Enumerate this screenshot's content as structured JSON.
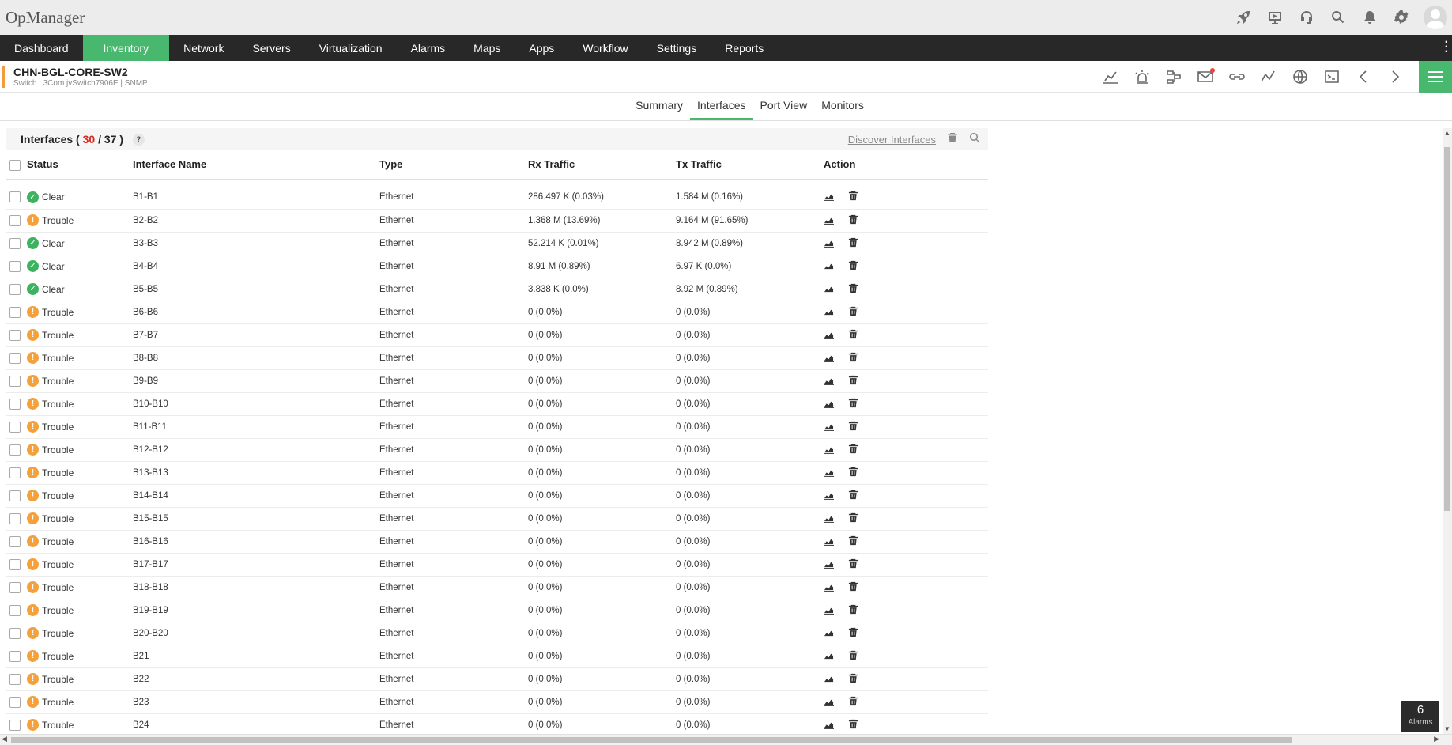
{
  "app": {
    "title": "OpMan​ager"
  },
  "nav": {
    "items": [
      "Dashboard",
      "Inventory",
      "Network",
      "Servers",
      "Virtualization",
      "Alarms",
      "Maps",
      "Apps",
      "Workflow",
      "Settings",
      "Reports"
    ],
    "active": "Inventory"
  },
  "device": {
    "name": "CHN-BGL-CORE-SW2",
    "subtitle": "Switch | 3Com jvSwitch7906E  | SNMP"
  },
  "tabs": {
    "items": [
      "Summary",
      "Interfaces",
      "Port View",
      "Monitors"
    ],
    "active": "Interfaces"
  },
  "interfaces": {
    "title": "Interfaces",
    "count_shown": "30",
    "count_total": "37",
    "discover_label": "Discover Interfaces",
    "columns": [
      "Status",
      "Interface Name",
      "Type",
      "Rx Traffic",
      "Tx Traffic",
      "Action"
    ],
    "rows": [
      {
        "status": "Clear",
        "name": "B1-B1",
        "type": "Ethernet",
        "rx": "286.497 K (0.03%)",
        "tx": "1.584 M (0.16%)"
      },
      {
        "status": "Trouble",
        "name": "B2-B2",
        "type": "Ethernet",
        "rx": "1.368 M (13.69%)",
        "tx": "9.164 M (91.65%)"
      },
      {
        "status": "Clear",
        "name": "B3-B3",
        "type": "Ethernet",
        "rx": "52.214 K (0.01%)",
        "tx": "8.942 M (0.89%)"
      },
      {
        "status": "Clear",
        "name": "B4-B4",
        "type": "Ethernet",
        "rx": "8.91 M (0.89%)",
        "tx": "6.97 K (0.0%)"
      },
      {
        "status": "Clear",
        "name": "B5-B5",
        "type": "Ethernet",
        "rx": "3.838 K (0.0%)",
        "tx": "8.92 M (0.89%)"
      },
      {
        "status": "Trouble",
        "name": "B6-B6",
        "type": "Ethernet",
        "rx": "0 (0.0%)",
        "tx": "0 (0.0%)"
      },
      {
        "status": "Trouble",
        "name": "B7-B7",
        "type": "Ethernet",
        "rx": "0 (0.0%)",
        "tx": "0 (0.0%)"
      },
      {
        "status": "Trouble",
        "name": "B8-B8",
        "type": "Ethernet",
        "rx": "0 (0.0%)",
        "tx": "0 (0.0%)"
      },
      {
        "status": "Trouble",
        "name": "B9-B9",
        "type": "Ethernet",
        "rx": "0 (0.0%)",
        "tx": "0 (0.0%)"
      },
      {
        "status": "Trouble",
        "name": "B10-B10",
        "type": "Ethernet",
        "rx": "0 (0.0%)",
        "tx": "0 (0.0%)"
      },
      {
        "status": "Trouble",
        "name": "B11-B11",
        "type": "Ethernet",
        "rx": "0 (0.0%)",
        "tx": "0 (0.0%)"
      },
      {
        "status": "Trouble",
        "name": "B12-B12",
        "type": "Ethernet",
        "rx": "0 (0.0%)",
        "tx": "0 (0.0%)"
      },
      {
        "status": "Trouble",
        "name": "B13-B13",
        "type": "Ethernet",
        "rx": "0 (0.0%)",
        "tx": "0 (0.0%)"
      },
      {
        "status": "Trouble",
        "name": "B14-B14",
        "type": "Ethernet",
        "rx": "0 (0.0%)",
        "tx": "0 (0.0%)"
      },
      {
        "status": "Trouble",
        "name": "B15-B15",
        "type": "Ethernet",
        "rx": "0 (0.0%)",
        "tx": "0 (0.0%)"
      },
      {
        "status": "Trouble",
        "name": "B16-B16",
        "type": "Ethernet",
        "rx": "0 (0.0%)",
        "tx": "0 (0.0%)"
      },
      {
        "status": "Trouble",
        "name": "B17-B17",
        "type": "Ethernet",
        "rx": "0 (0.0%)",
        "tx": "0 (0.0%)"
      },
      {
        "status": "Trouble",
        "name": "B18-B18",
        "type": "Ethernet",
        "rx": "0 (0.0%)",
        "tx": "0 (0.0%)"
      },
      {
        "status": "Trouble",
        "name": "B19-B19",
        "type": "Ethernet",
        "rx": "0 (0.0%)",
        "tx": "0 (0.0%)"
      },
      {
        "status": "Trouble",
        "name": "B20-B20",
        "type": "Ethernet",
        "rx": "0 (0.0%)",
        "tx": "0 (0.0%)"
      },
      {
        "status": "Trouble",
        "name": "B21",
        "type": "Ethernet",
        "rx": "0 (0.0%)",
        "tx": "0 (0.0%)"
      },
      {
        "status": "Trouble",
        "name": "B22",
        "type": "Ethernet",
        "rx": "0 (0.0%)",
        "tx": "0 (0.0%)"
      },
      {
        "status": "Trouble",
        "name": "B23",
        "type": "Ethernet",
        "rx": "0 (0.0%)",
        "tx": "0 (0.0%)"
      },
      {
        "status": "Trouble",
        "name": "B24",
        "type": "Ethernet",
        "rx": "0 (0.0%)",
        "tx": "0 (0.0%)"
      }
    ]
  },
  "alarms": {
    "count": "6",
    "label": "Alarms"
  },
  "colors": {
    "accent": "#48b86e",
    "nav_bg": "#282828",
    "clear": "#3bb35f",
    "trouble": "#f4a13c",
    "count_red": "#d9281c"
  }
}
